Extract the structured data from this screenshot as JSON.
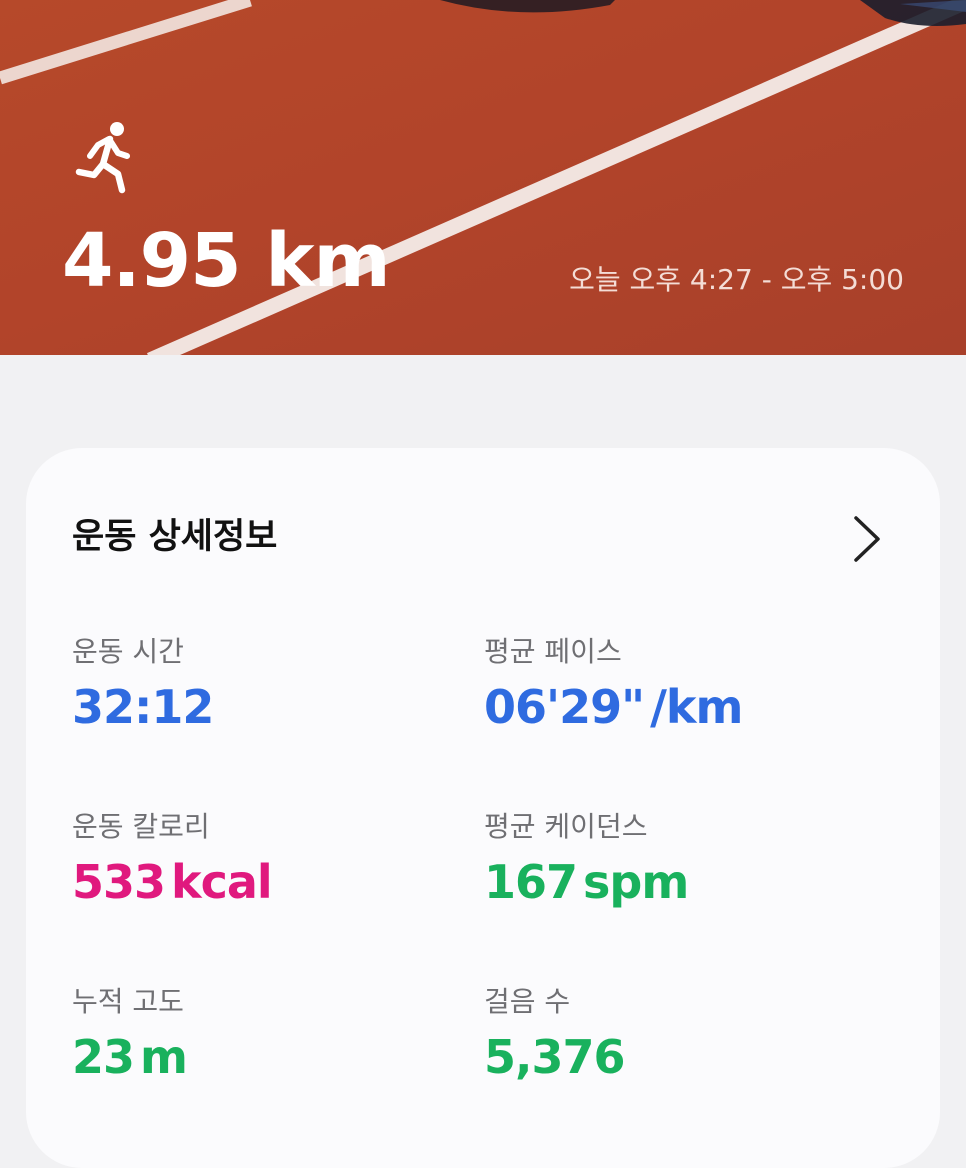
{
  "hero": {
    "activity_icon": "running-person-icon",
    "distance": "4.95 km",
    "time_range": "오늘 오후 4:27 - 오후 5:00"
  },
  "details": {
    "title": "운동 상세정보",
    "chevron_icon": "chevron-right-icon",
    "stats": [
      {
        "label": "운동 시간",
        "value": "32:12",
        "unit": "",
        "color": "#2f6be0"
      },
      {
        "label": "평균 페이스",
        "value": "06'29\"",
        "unit": "/km",
        "color": "#2f6be0"
      },
      {
        "label": "운동 칼로리",
        "value": "533",
        "unit": "kcal",
        "color": "#e0197e"
      },
      {
        "label": "평균 케이던스",
        "value": "167",
        "unit": "spm",
        "color": "#19b15d"
      },
      {
        "label": "누적 고도",
        "value": "23",
        "unit": "m",
        "color": "#19b15d"
      },
      {
        "label": "걸음 수",
        "value": "5,376",
        "unit": "",
        "color": "#19b15d"
      }
    ]
  }
}
